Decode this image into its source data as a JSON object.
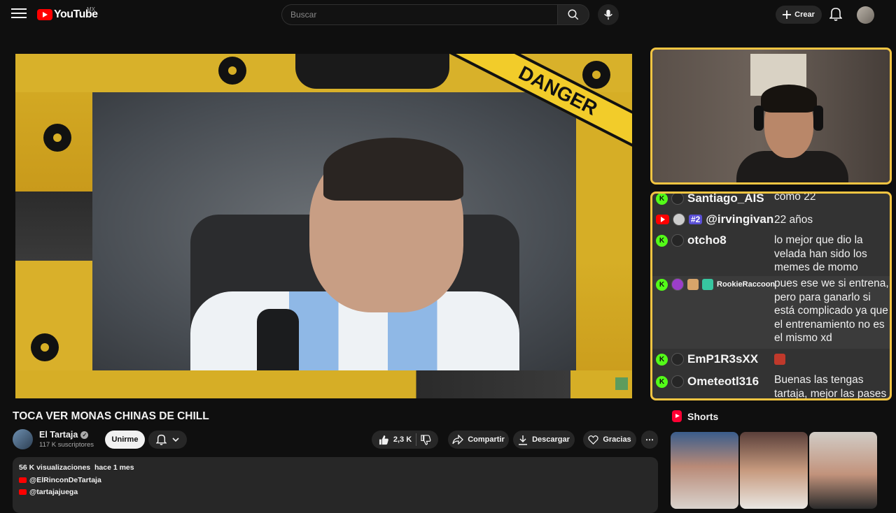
{
  "header": {
    "logo_text": "YouTube",
    "country": "MX",
    "search_placeholder": "Buscar",
    "create_label": "Crear"
  },
  "player": {
    "overlay_text": "DANGER"
  },
  "chat": {
    "messages": [
      {
        "platform": "kick",
        "user": "Santiago_AIS",
        "text": "como 22"
      },
      {
        "platform": "youtube",
        "badge": "#2",
        "user": "@irvingivan",
        "text": "22 años"
      },
      {
        "platform": "kick",
        "user": "otcho8",
        "text": "lo mejor que dio la velada han sido los memes de momo"
      },
      {
        "platform": "kick",
        "user": "RookieRaccoon",
        "text": "pues ese we si entrena, pero para ganarlo si está complicado ya que el entrenamiento no es el mismo xd"
      },
      {
        "platform": "kick",
        "user": "EmP1R3sXX",
        "text": ""
      },
      {
        "platform": "kick",
        "user": "Ometeotl316",
        "text": "Buenas las tengas tartaja, mejor las pases"
      }
    ]
  },
  "video": {
    "title": "TOCA VER MONAS CHINAS DE CHILL",
    "channel_name": "El Tartaja",
    "subscribers": "117 K suscriptores",
    "join_label": "Unirme",
    "likes": "2,3 K",
    "share_label": "Compartir",
    "download_label": "Descargar",
    "thanks_label": "Gracias"
  },
  "description": {
    "views": "56 K visualizaciones",
    "date": "hace 1 mes",
    "links": [
      "@ElRinconDeTartaja",
      "@tartajajuega"
    ]
  },
  "shorts": {
    "heading": "Shorts"
  },
  "colors": {
    "accent_frame": "#f4c542",
    "kick_green": "#53fc18",
    "youtube_red": "#ff0000"
  }
}
